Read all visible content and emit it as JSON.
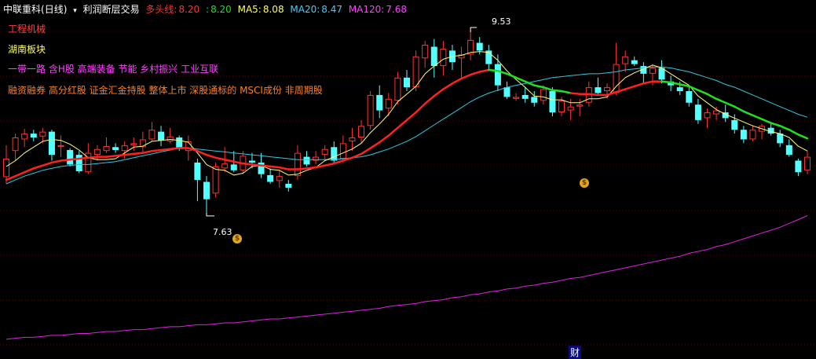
{
  "header": {
    "stock": "中联重科",
    "period": "(日线)",
    "indicator": "利润断层交易",
    "dtx_label": "多头线:",
    "dtx_red": "8.20",
    "dtx_green": "8.20",
    "ma5_label": "MA5:",
    "ma5": "8.08",
    "ma20_label": "MA20:",
    "ma20": "8.47",
    "ma120_label": "MA120:",
    "ma120": "7.68"
  },
  "tags": {
    "line1": "工程机械",
    "line2": "湖南板块",
    "line3": "一带一路 含H股 高端装备 节能 乡村振兴 工业互联",
    "line4": "融资融券 高分红股 证金汇金持股 整体上市 深股通标的 MSCI成份 非周期股"
  },
  "markers": {
    "high_label": "9.53",
    "low_label": "7.63",
    "money_symbol": "$",
    "cai": "财"
  },
  "colors": {
    "up": "#ff3232",
    "down": "#54ffff",
    "ma5": "#ffff80",
    "ma20": "#30c8e0",
    "ma120": "#e020e0",
    "dtx_red": "#ff2020",
    "dtx_green": "#20e020",
    "header_red": "#ff3232",
    "header_green": "#20e020",
    "header_yellow": "#ffff60",
    "header_cyan": "#40d0ff",
    "header_magenta": "#ff40ff",
    "tag1": "#ff4040",
    "tag2": "#ffff60",
    "tag3": "#ff40ff",
    "tag4": "#ff8020"
  },
  "chart_data": {
    "type": "candlestick",
    "ylim": [
      6.3,
      9.75
    ],
    "high_mark": 9.53,
    "low_mark": 7.63,
    "candles": [
      [
        8.03,
        8.36,
        7.96,
        8.22
      ],
      [
        8.3,
        8.48,
        8.2,
        8.44
      ],
      [
        8.42,
        8.53,
        8.34,
        8.48
      ],
      [
        8.48,
        8.52,
        8.4,
        8.44
      ],
      [
        8.45,
        8.54,
        8.38,
        8.5
      ],
      [
        8.5,
        8.52,
        8.2,
        8.26
      ],
      [
        8.35,
        8.46,
        8.24,
        8.36
      ],
      [
        8.31,
        8.33,
        8.14,
        8.16
      ],
      [
        8.26,
        8.3,
        8.07,
        8.09
      ],
      [
        8.08,
        8.38,
        8.06,
        8.28
      ],
      [
        8.26,
        8.36,
        8.2,
        8.32
      ],
      [
        8.3,
        8.44,
        8.28,
        8.35
      ],
      [
        8.34,
        8.38,
        8.28,
        8.31
      ],
      [
        8.3,
        8.4,
        8.22,
        8.36
      ],
      [
        8.36,
        8.44,
        8.3,
        8.38
      ],
      [
        8.34,
        8.5,
        8.28,
        8.42
      ],
      [
        8.42,
        8.6,
        8.4,
        8.52
      ],
      [
        8.5,
        8.56,
        8.35,
        8.41
      ],
      [
        8.4,
        8.54,
        8.38,
        8.45
      ],
      [
        8.44,
        8.46,
        8.3,
        8.32
      ],
      [
        8.3,
        8.46,
        8.2,
        8.4
      ],
      [
        8.18,
        8.22,
        7.78,
        8.0
      ],
      [
        7.98,
        8.04,
        7.66,
        7.8
      ],
      [
        7.86,
        8.18,
        7.82,
        8.14
      ],
      [
        8.12,
        8.34,
        8.08,
        8.17
      ],
      [
        8.16,
        8.3,
        8.08,
        8.1
      ],
      [
        8.1,
        8.3,
        8.06,
        8.25
      ],
      [
        8.2,
        8.28,
        8.12,
        8.18
      ],
      [
        8.18,
        8.28,
        8.02,
        8.06
      ],
      [
        8.05,
        8.12,
        7.96,
        7.98
      ],
      [
        7.99,
        8.1,
        7.92,
        8.04
      ],
      [
        7.96,
        8.0,
        7.88,
        7.92
      ],
      [
        8.04,
        8.36,
        8.0,
        8.28
      ],
      [
        8.24,
        8.3,
        8.14,
        8.16
      ],
      [
        8.2,
        8.3,
        8.16,
        8.24
      ],
      [
        8.26,
        8.36,
        8.2,
        8.32
      ],
      [
        8.34,
        8.4,
        8.18,
        8.2
      ],
      [
        8.22,
        8.46,
        8.18,
        8.38
      ],
      [
        8.4,
        8.54,
        8.3,
        8.44
      ],
      [
        8.44,
        8.62,
        8.38,
        8.56
      ],
      [
        8.56,
        8.92,
        8.52,
        8.88
      ],
      [
        8.88,
        8.98,
        8.64,
        8.72
      ],
      [
        8.74,
        8.9,
        8.66,
        8.84
      ],
      [
        8.82,
        9.12,
        8.78,
        9.06
      ],
      [
        9.06,
        9.14,
        8.92,
        8.96
      ],
      [
        8.96,
        9.34,
        8.92,
        9.28
      ],
      [
        9.26,
        9.44,
        9.16,
        9.4
      ],
      [
        9.38,
        9.46,
        9.06,
        9.18
      ],
      [
        9.18,
        9.44,
        9.08,
        9.36
      ],
      [
        9.34,
        9.4,
        9.14,
        9.22
      ],
      [
        9.26,
        9.38,
        9.06,
        9.3
      ],
      [
        9.3,
        9.53,
        9.24,
        9.45
      ],
      [
        9.42,
        9.48,
        9.3,
        9.34
      ],
      [
        9.34,
        9.4,
        9.14,
        9.2
      ],
      [
        9.2,
        9.3,
        8.92,
        8.98
      ],
      [
        8.96,
        9.02,
        8.84,
        8.86
      ],
      [
        8.84,
        8.9,
        8.82,
        8.86
      ],
      [
        8.88,
        8.96,
        8.8,
        8.84
      ],
      [
        8.86,
        8.92,
        8.76,
        8.8
      ],
      [
        8.82,
        8.98,
        8.78,
        8.94
      ],
      [
        8.92,
        8.96,
        8.66,
        8.7
      ],
      [
        8.7,
        8.86,
        8.66,
        8.82
      ],
      [
        8.72,
        8.84,
        8.62,
        8.76
      ],
      [
        8.76,
        8.84,
        8.66,
        8.78
      ],
      [
        8.8,
        9.02,
        8.76,
        8.96
      ],
      [
        8.96,
        9.06,
        8.88,
        8.9
      ],
      [
        8.92,
        9.0,
        8.84,
        8.96
      ],
      [
        8.9,
        9.42,
        8.88,
        9.2
      ],
      [
        9.2,
        9.34,
        9.12,
        9.28
      ],
      [
        9.24,
        9.28,
        9.18,
        9.2
      ],
      [
        9.18,
        9.22,
        9.0,
        9.1
      ],
      [
        9.1,
        9.2,
        8.98,
        9.16
      ],
      [
        9.16,
        9.24,
        9.0,
        9.04
      ],
      [
        9.02,
        9.08,
        8.92,
        8.98
      ],
      [
        8.96,
        9.02,
        8.88,
        8.92
      ],
      [
        8.92,
        8.96,
        8.76,
        8.8
      ],
      [
        8.78,
        8.84,
        8.58,
        8.62
      ],
      [
        8.64,
        8.74,
        8.54,
        8.7
      ],
      [
        8.68,
        8.76,
        8.62,
        8.72
      ],
      [
        8.7,
        8.78,
        8.6,
        8.64
      ],
      [
        8.62,
        8.68,
        8.48,
        8.52
      ],
      [
        8.52,
        8.56,
        8.38,
        8.42
      ],
      [
        8.42,
        8.56,
        8.4,
        8.52
      ],
      [
        8.5,
        8.58,
        8.42,
        8.56
      ],
      [
        8.54,
        8.6,
        8.46,
        8.48
      ],
      [
        8.48,
        8.52,
        8.34,
        8.38
      ],
      [
        8.36,
        8.42,
        8.24,
        8.26
      ],
      [
        8.2,
        8.22,
        8.04,
        8.08
      ],
      [
        8.1,
        8.3,
        8.06,
        8.24
      ]
    ],
    "ma5": [
      8.14,
      8.2,
      8.28,
      8.34,
      8.4,
      8.42,
      8.41,
      8.37,
      8.31,
      8.23,
      8.21,
      8.21,
      8.22,
      8.28,
      8.34,
      8.35,
      8.4,
      8.41,
      8.42,
      8.41,
      8.39,
      8.28,
      8.16,
      8.11,
      8.1,
      8.05,
      8.07,
      8.14,
      8.15,
      8.11,
      8.1,
      8.05,
      8.06,
      8.1,
      8.13,
      8.2,
      8.24,
      8.28,
      8.32,
      8.38,
      8.49,
      8.58,
      8.68,
      8.81,
      8.89,
      8.97,
      9.1,
      9.18,
      9.25,
      9.28,
      9.29,
      9.32,
      9.33,
      9.32,
      9.24,
      9.13,
      9.04,
      8.96,
      8.87,
      8.86,
      8.83,
      8.83,
      8.8,
      8.8,
      8.84,
      8.84,
      8.86,
      8.97,
      9.06,
      9.11,
      9.15,
      9.19,
      9.16,
      9.1,
      9.04,
      8.98,
      8.87,
      8.8,
      8.73,
      8.68,
      8.64,
      8.6,
      8.56,
      8.53,
      8.5,
      8.48,
      8.44,
      8.35,
      8.3
    ],
    "ma20": [
      7.96,
      8.0,
      8.04,
      8.07,
      8.1,
      8.12,
      8.14,
      8.15,
      8.16,
      8.16,
      8.17,
      8.18,
      8.19,
      8.21,
      8.23,
      8.25,
      8.27,
      8.29,
      8.31,
      8.33,
      8.33,
      8.32,
      8.31,
      8.3,
      8.29,
      8.28,
      8.27,
      8.26,
      8.25,
      8.24,
      8.23,
      8.22,
      8.21,
      8.21,
      8.21,
      8.21,
      8.21,
      8.22,
      8.23,
      8.24,
      8.26,
      8.29,
      8.32,
      8.36,
      8.4,
      8.45,
      8.51,
      8.57,
      8.63,
      8.69,
      8.75,
      8.81,
      8.86,
      8.9,
      8.93,
      8.96,
      8.98,
      9.0,
      9.02,
      9.04,
      9.06,
      9.07,
      9.08,
      9.09,
      9.1,
      9.1,
      9.11,
      9.12,
      9.14,
      9.15,
      9.16,
      9.17,
      9.17,
      9.16,
      9.14,
      9.12,
      9.09,
      9.06,
      9.03,
      8.99,
      8.96,
      8.92,
      8.88,
      8.84,
      8.8,
      8.76,
      8.72,
      8.68,
      8.65
    ],
    "ma120": [
      6.35,
      6.36,
      6.37,
      6.37,
      6.38,
      6.39,
      6.39,
      6.4,
      6.41,
      6.41,
      6.42,
      6.43,
      6.43,
      6.44,
      6.45,
      6.45,
      6.46,
      6.47,
      6.48,
      6.48,
      6.49,
      6.5,
      6.5,
      6.51,
      6.52,
      6.52,
      6.53,
      6.54,
      6.55,
      6.56,
      6.56,
      6.57,
      6.58,
      6.59,
      6.6,
      6.61,
      6.62,
      6.63,
      6.64,
      6.65,
      6.66,
      6.67,
      6.69,
      6.7,
      6.71,
      6.72,
      6.74,
      6.75,
      6.76,
      6.78,
      6.79,
      6.81,
      6.82,
      6.84,
      6.85,
      6.87,
      6.88,
      6.9,
      6.91,
      6.93,
      6.94,
      6.96,
      6.98,
      6.99,
      7.01,
      7.03,
      7.05,
      7.07,
      7.09,
      7.11,
      7.13,
      7.15,
      7.17,
      7.19,
      7.21,
      7.24,
      7.26,
      7.28,
      7.31,
      7.33,
      7.36,
      7.39,
      7.42,
      7.45,
      7.48,
      7.51,
      7.55,
      7.59,
      7.63
    ],
    "dtx": [
      8.0,
      8.04,
      8.08,
      8.12,
      8.15,
      8.18,
      8.2,
      8.21,
      8.22,
      8.23,
      8.24,
      8.24,
      8.25,
      8.26,
      8.27,
      8.28,
      8.3,
      8.31,
      8.32,
      8.33,
      8.33,
      8.3,
      8.26,
      8.23,
      8.21,
      8.19,
      8.17,
      8.16,
      8.15,
      8.14,
      8.13,
      8.11,
      8.11,
      8.12,
      8.13,
      8.15,
      8.17,
      8.2,
      8.23,
      8.27,
      8.33,
      8.39,
      8.46,
      8.54,
      8.62,
      8.7,
      8.79,
      8.87,
      8.94,
      9.0,
      9.05,
      9.09,
      9.12,
      9.14,
      9.13,
      9.1,
      9.06,
      9.02,
      8.98,
      8.96,
      8.93,
      8.92,
      8.9,
      8.89,
      8.89,
      8.88,
      8.88,
      8.91,
      8.94,
      8.97,
      9.0,
      9.02,
      9.02,
      9.01,
      8.99,
      8.97,
      8.93,
      8.89,
      8.84,
      8.8,
      8.76,
      8.71,
      8.67,
      8.63,
      8.59,
      8.56,
      8.52,
      8.47,
      8.43
    ],
    "dtx_bull_ranges": [
      [
        0,
        33
      ],
      [
        34,
        53
      ],
      [
        62,
        72
      ]
    ]
  }
}
